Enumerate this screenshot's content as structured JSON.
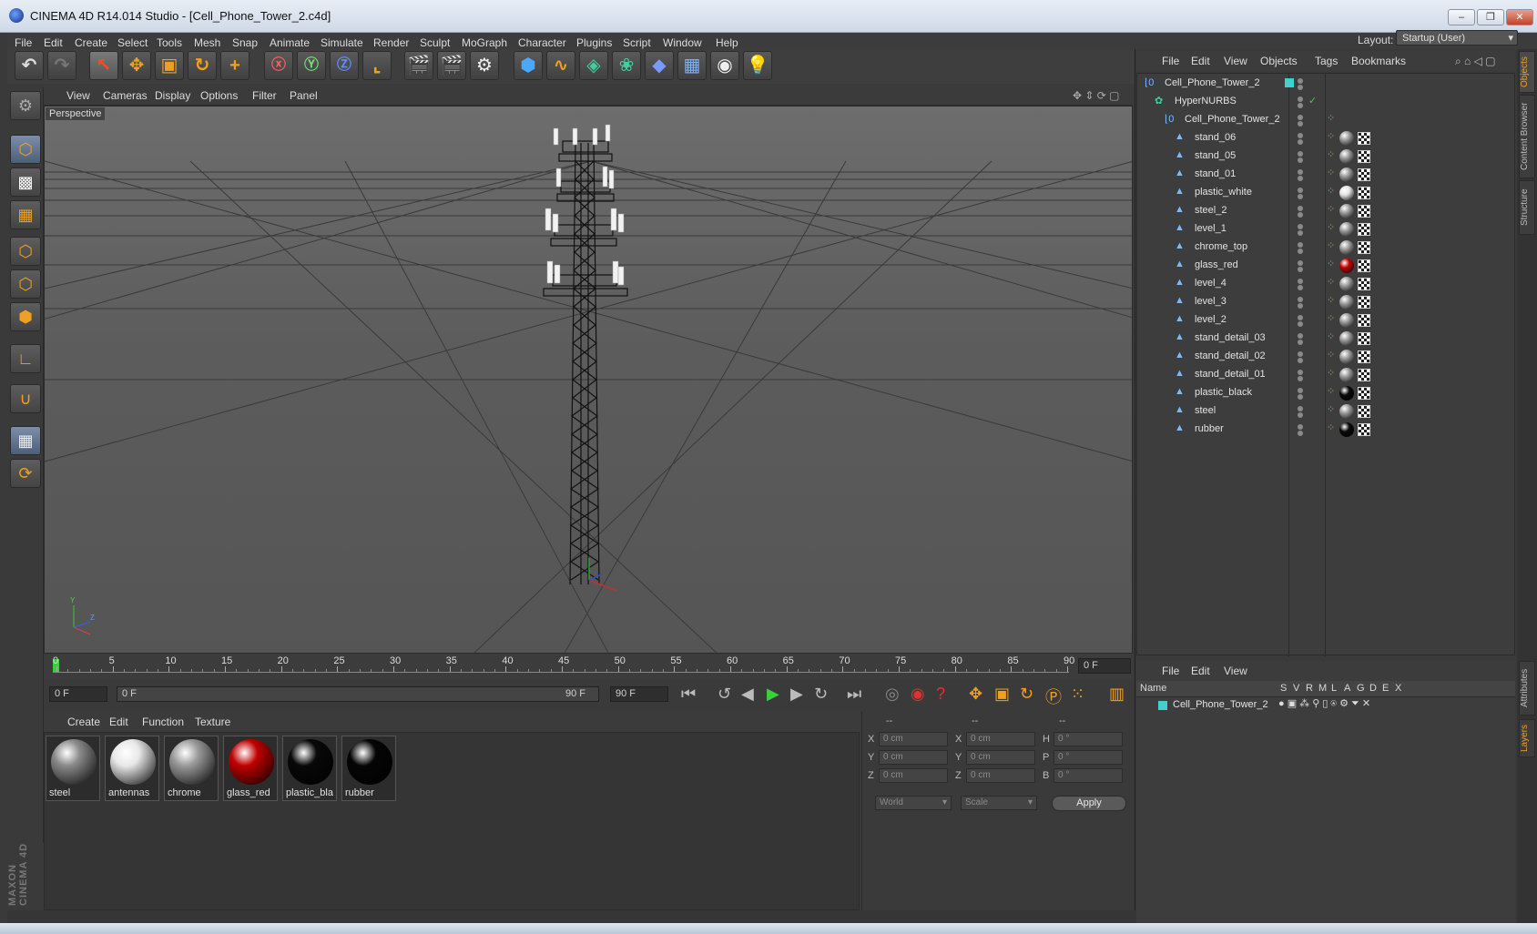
{
  "window": {
    "title": "CINEMA 4D R14.014 Studio - [Cell_Phone_Tower_2.c4d]",
    "min": "–",
    "max": "❐",
    "close": "✕"
  },
  "menubar": [
    "File",
    "Edit",
    "Create",
    "Select",
    "Tools",
    "Mesh",
    "Snap",
    "Animate",
    "Simulate",
    "Render",
    "Sculpt",
    "MoGraph",
    "Character",
    "Plugins",
    "Script",
    "Window",
    "Help"
  ],
  "layout": {
    "label": "Layout:",
    "value": "Startup (User)"
  },
  "toolbar_icons": [
    "undo-icon",
    "redo-icon",
    "live-select-icon",
    "move-icon",
    "scale-icon",
    "rotate-icon",
    "add-icon",
    "x-axis-icon",
    "y-axis-icon",
    "z-axis-icon",
    "world-coords-icon",
    "render-view-icon",
    "render-picture-viewer-icon",
    "render-settings-icon",
    "cube-icon",
    "spline-pen-icon",
    "subdivision-icon",
    "mograph-cloner-icon",
    "deformer-icon",
    "floor-icon",
    "camera-icon",
    "light-icon"
  ],
  "viewport": {
    "menu": [
      "View",
      "Cameras",
      "Display",
      "Options",
      "Filter",
      "Panel"
    ],
    "label": "Perspective"
  },
  "timeline": {
    "ticks": [
      "0",
      "5",
      "10",
      "15",
      "20",
      "25",
      "30",
      "35",
      "40",
      "45",
      "50",
      "55",
      "60",
      "65",
      "70",
      "75",
      "80",
      "85",
      "90"
    ],
    "current_frame": "0 F",
    "start": "0 F",
    "range_start": "0 F",
    "range_end": "90 F",
    "end": "90 F"
  },
  "materials": {
    "menu": [
      "Create",
      "Edit",
      "Function",
      "Texture"
    ],
    "items": [
      {
        "name": "steel",
        "color": "#8a8a8a"
      },
      {
        "name": "antennas",
        "color": "#e8e8e8"
      },
      {
        "name": "chrome",
        "color": "#9a9a9a"
      },
      {
        "name": "glass_red",
        "color": "#c00000"
      },
      {
        "name": "plastic_bla",
        "color": "#080808"
      },
      {
        "name": "rubber",
        "color": "#050505"
      }
    ]
  },
  "coordinates": {
    "header": [
      "--",
      "--",
      "--"
    ],
    "rows": [
      {
        "a": "X",
        "av": "0 cm",
        "b": "X",
        "bv": "0 cm",
        "c": "H",
        "cv": "0 °"
      },
      {
        "a": "Y",
        "av": "0 cm",
        "b": "Y",
        "bv": "0 cm",
        "c": "P",
        "cv": "0 °"
      },
      {
        "a": "Z",
        "av": "0 cm",
        "b": "Z",
        "bv": "0 cm",
        "c": "B",
        "cv": "0 °"
      }
    ],
    "mode": "World",
    "type": "Scale",
    "apply": "Apply"
  },
  "objects": {
    "menu": [
      "File",
      "Edit",
      "View",
      "Objects",
      "Tags",
      "Bookmarks"
    ],
    "tree": [
      {
        "name": "Cell_Phone_Tower_2",
        "depth": 0,
        "icon": "null"
      },
      {
        "name": "HyperNURBS",
        "depth": 1,
        "icon": "nurbs"
      },
      {
        "name": "Cell_Phone_Tower_2",
        "depth": 2,
        "icon": "null"
      },
      {
        "name": "stand_06",
        "depth": 3,
        "icon": "poly",
        "mat": "#9a9a9a"
      },
      {
        "name": "stand_05",
        "depth": 3,
        "icon": "poly",
        "mat": "#9a9a9a"
      },
      {
        "name": "stand_01",
        "depth": 3,
        "icon": "poly",
        "mat": "#9a9a9a"
      },
      {
        "name": "plastic_white",
        "depth": 3,
        "icon": "poly",
        "mat": "#e6e6e6"
      },
      {
        "name": "steel_2",
        "depth": 3,
        "icon": "poly",
        "mat": "#9a9a9a"
      },
      {
        "name": "level_1",
        "depth": 3,
        "icon": "poly",
        "mat": "#9a9a9a"
      },
      {
        "name": "chrome_top",
        "depth": 3,
        "icon": "poly",
        "mat": "#9a9a9a"
      },
      {
        "name": "glass_red",
        "depth": 3,
        "icon": "poly",
        "mat": "#c00000"
      },
      {
        "name": "level_4",
        "depth": 3,
        "icon": "poly",
        "mat": "#9a9a9a"
      },
      {
        "name": "level_3",
        "depth": 3,
        "icon": "poly",
        "mat": "#9a9a9a"
      },
      {
        "name": "level_2",
        "depth": 3,
        "icon": "poly",
        "mat": "#9a9a9a"
      },
      {
        "name": "stand_detail_03",
        "depth": 3,
        "icon": "poly",
        "mat": "#9a9a9a"
      },
      {
        "name": "stand_detail_02",
        "depth": 3,
        "icon": "poly",
        "mat": "#9a9a9a"
      },
      {
        "name": "stand_detail_01",
        "depth": 3,
        "icon": "poly",
        "mat": "#9a9a9a"
      },
      {
        "name": "plastic_black",
        "depth": 3,
        "icon": "poly",
        "mat": "#0a0a0a"
      },
      {
        "name": "steel",
        "depth": 3,
        "icon": "poly",
        "mat": "#9a9a9a"
      },
      {
        "name": "rubber",
        "depth": 3,
        "icon": "poly",
        "mat": "#0a0a0a"
      }
    ]
  },
  "layers": {
    "menu": [
      "File",
      "Edit",
      "View"
    ],
    "columns": {
      "name": "Name",
      "flags": [
        "S",
        "V",
        "R",
        "M",
        "L",
        "A",
        "G",
        "D",
        "E",
        "X"
      ]
    },
    "rows": [
      {
        "name": "Cell_Phone_Tower_2",
        "color": "#3fd0d0"
      }
    ]
  },
  "side_tabs": [
    "Objects",
    "Content Browser",
    "Structure",
    "Attributes",
    "Layers"
  ],
  "brand": "MAXON CINEMA 4D",
  "colors": {
    "accent": "#f0a020",
    "selection": "#3fd0d0"
  }
}
